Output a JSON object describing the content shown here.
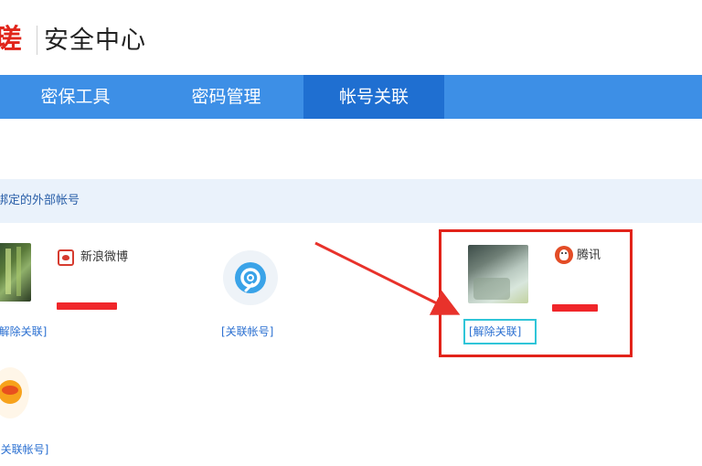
{
  "header": {
    "logo_fragment": "瑳",
    "title": "安全中心"
  },
  "nav": {
    "items": [
      {
        "label": "密保工具"
      },
      {
        "label": "密码管理"
      },
      {
        "label": "帐号关联"
      }
    ],
    "active_index": 2
  },
  "section": {
    "title": "绑定的外部帐号"
  },
  "accounts": [
    {
      "platform": "新浪微博",
      "link": "[解除关联]",
      "bound": true
    },
    {
      "platform": "",
      "link": "[关联帐号]",
      "bound": false
    },
    {
      "platform": "腾讯",
      "link": "[解除关联]",
      "bound": true
    },
    {
      "platform": "",
      "link": "[关联帐号]",
      "bound": false
    }
  ],
  "colors": {
    "brand_red": "#e1251b",
    "nav_blue": "#3d8fe6",
    "nav_active": "#1f6fd1",
    "link_blue": "#2a6fd1",
    "section_bg": "#eaf2fb",
    "annotation_red": "#e2231a",
    "annotation_cyan": "#2fc5d8"
  },
  "icons": {
    "weibo": "weibo-icon",
    "link_account": "chain-link-icon",
    "qq": "qq-penguin-icon",
    "taobao": "taobao-icon"
  }
}
